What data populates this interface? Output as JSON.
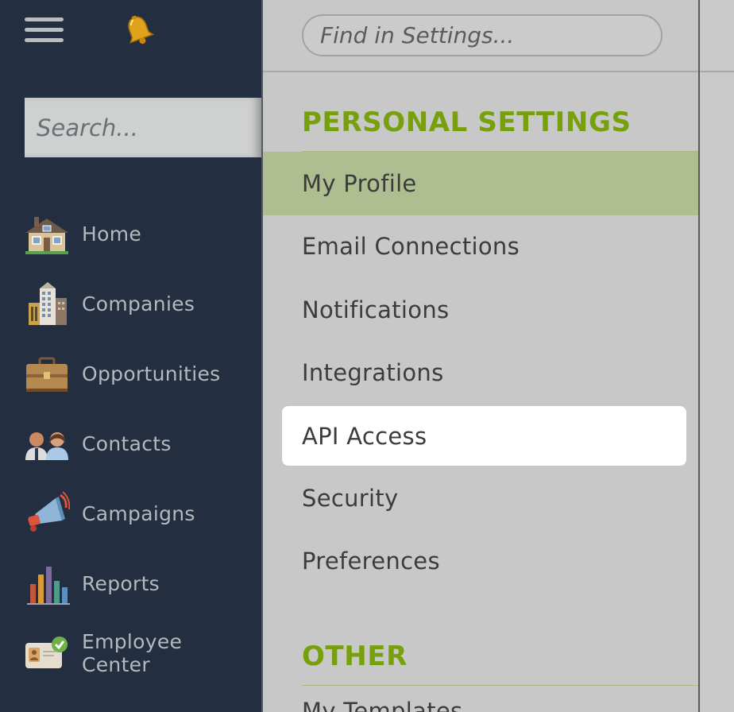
{
  "sidebar": {
    "search_placeholder": "Search...",
    "items": [
      {
        "label": "Home",
        "icon": "home-icon"
      },
      {
        "label": "Companies",
        "icon": "buildings-icon"
      },
      {
        "label": "Opportunities",
        "icon": "briefcase-icon"
      },
      {
        "label": "Contacts",
        "icon": "people-icon"
      },
      {
        "label": "Campaigns",
        "icon": "megaphone-icon"
      },
      {
        "label": "Reports",
        "icon": "bar-chart-icon"
      },
      {
        "label_line1": "Employee",
        "label_line2": "Center",
        "icon": "id-card-icon"
      }
    ]
  },
  "settings": {
    "find_placeholder": "Find in Settings...",
    "personal_title": "PERSONAL SETTINGS",
    "personal_items": [
      "My Profile",
      "Email Connections",
      "Notifications",
      "Integrations",
      "API Access",
      "Security",
      "Preferences"
    ],
    "other_title": "OTHER",
    "other_items": [
      "My Templates"
    ]
  },
  "colors": {
    "sidebar_bg": "#232f40",
    "accent_green": "#76a00c",
    "active_row": "#afbe91",
    "panel_bg": "#c8c8c8"
  }
}
